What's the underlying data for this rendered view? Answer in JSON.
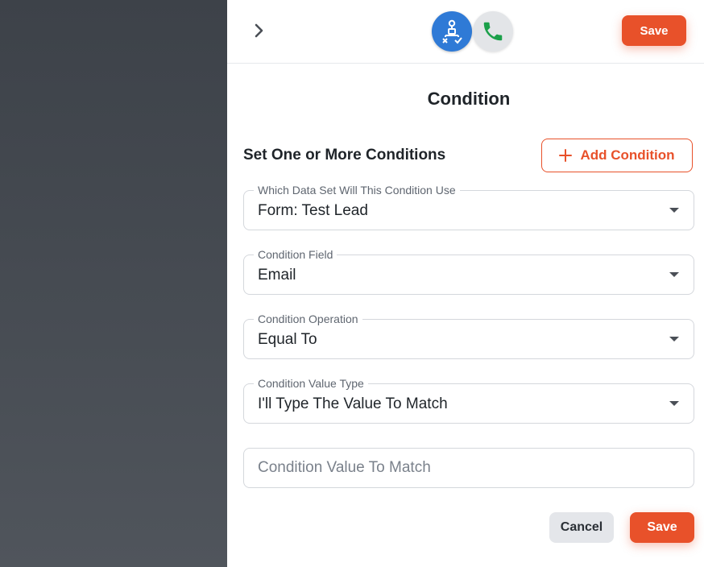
{
  "header": {
    "collapse_icon": "chevron-right-icon",
    "workflow_icon": "flowchart-icon",
    "phone_icon": "phone-icon",
    "save_label": "Save",
    "colors": {
      "accent": "#e8512a",
      "workflow_bg": "#2f7ad6",
      "phone_green": "#1ba04a"
    }
  },
  "main": {
    "title": "Condition",
    "section_label": "Set One or More Conditions",
    "add_condition_label": "Add Condition",
    "fields": [
      {
        "label": "Which Data Set Will This Condition Use",
        "value": "Form: Test Lead"
      },
      {
        "label": "Condition Field",
        "value": "Email"
      },
      {
        "label": "Condition Operation",
        "value": "Equal To"
      },
      {
        "label": "Condition Value Type",
        "value": "I'll Type The Value To Match"
      }
    ],
    "value_input": {
      "placeholder": "Condition Value To Match",
      "value": ""
    }
  },
  "footer": {
    "cancel_label": "Cancel",
    "save_label": "Save"
  }
}
